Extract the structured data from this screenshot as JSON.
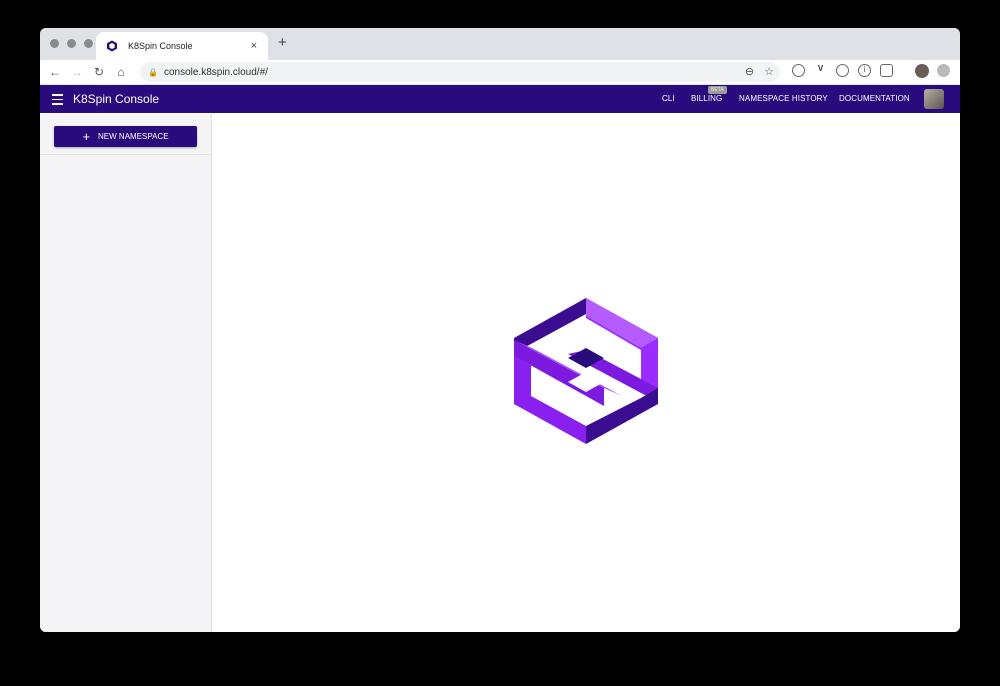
{
  "browser": {
    "tab_title": "K8Spin Console",
    "tab_close": "×",
    "new_tab": "+",
    "url": "console.k8spin.cloud/#/"
  },
  "app": {
    "title": "K8Spin Console",
    "nav": {
      "cli": "CLI",
      "billing": "BILLING",
      "billing_badge": "BETA",
      "history": "NAMESPACE HISTORY",
      "docs": "DOCUMENTATION"
    },
    "sidebar": {
      "new_namespace_label": "NEW NAMESPACE"
    }
  },
  "colors": {
    "primary": "#2a0b7e",
    "logo_light": "#9b30ff",
    "logo_dark": "#3d0f8f"
  },
  "icons": [
    "k8spin-favicon",
    "back-arrow-icon",
    "forward-arrow-icon",
    "reload-icon",
    "home-icon",
    "lock-icon",
    "zoom-icon",
    "star-icon",
    "menu-icon",
    "plus-icon",
    "k8spin-logo"
  ]
}
